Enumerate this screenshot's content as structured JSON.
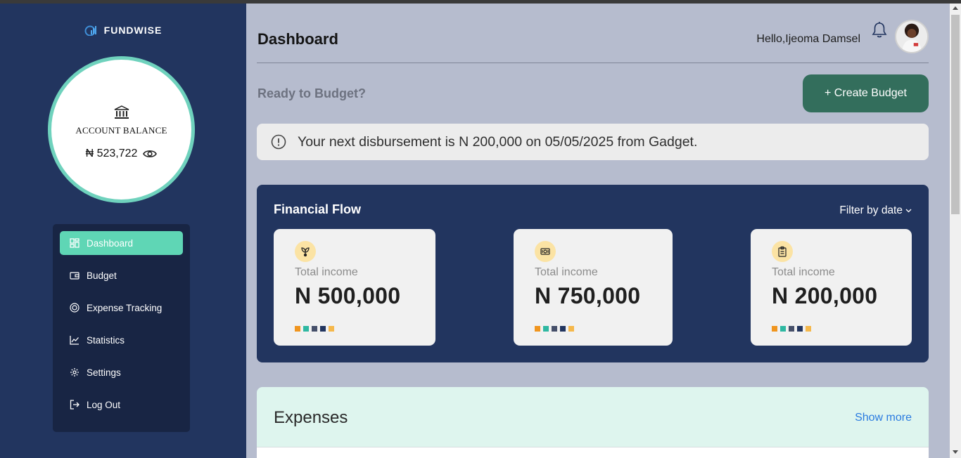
{
  "brand": {
    "name": "FUNDWISE",
    "logo_icon": "bar-chart-logo-icon"
  },
  "balance": {
    "icon": "bank-icon",
    "label": "ACCOUNT BALANCE",
    "amount": "₦ 523,722",
    "toggle_icon": "eye-icon"
  },
  "sidebar": {
    "items": [
      {
        "label": "Dashboard",
        "icon": "grid-icon",
        "active": true
      },
      {
        "label": "Budget",
        "icon": "wallet-icon",
        "active": false
      },
      {
        "label": "Expense Tracking",
        "icon": "coin-icon",
        "active": false
      },
      {
        "label": "Statistics",
        "icon": "trend-icon",
        "active": false
      },
      {
        "label": "Settings",
        "icon": "gear-icon",
        "active": false
      },
      {
        "label": "Log Out",
        "icon": "logout-icon",
        "active": false
      }
    ]
  },
  "header": {
    "title": "Dashboard",
    "greeting": "Hello,Ijeoma Damsel",
    "bell_icon": "bell-icon",
    "avatar": "user-avatar"
  },
  "budget_prompt": {
    "text": "Ready to Budget?",
    "button": "+ Create Budget"
  },
  "notice": {
    "icon": "info-icon",
    "text": "Your next disbursement is N 200,000 on 05/05/2025 from Gadget."
  },
  "financial_flow": {
    "title": "Financial Flow",
    "filter_label": "Filter by date",
    "cards": [
      {
        "icon": "plant-icon",
        "label": "Total income",
        "value": "N 500,000"
      },
      {
        "icon": "money-icon",
        "label": "Total income",
        "value": "N 750,000"
      },
      {
        "icon": "clipboard-icon",
        "label": "Total income",
        "value": "N 200,000"
      }
    ],
    "dot_colors": [
      "#f0951f",
      "#2fb8a2",
      "#46506a",
      "#22355f",
      "#f5b84c"
    ]
  },
  "expenses": {
    "title": "Expenses",
    "link": "Show more"
  },
  "colors": {
    "sidebar_bg": "#22355f",
    "accent_teal": "#5fd6b5",
    "primary_button": "#336e5c",
    "main_bg": "#b6bcce",
    "link": "#2a7be0"
  }
}
